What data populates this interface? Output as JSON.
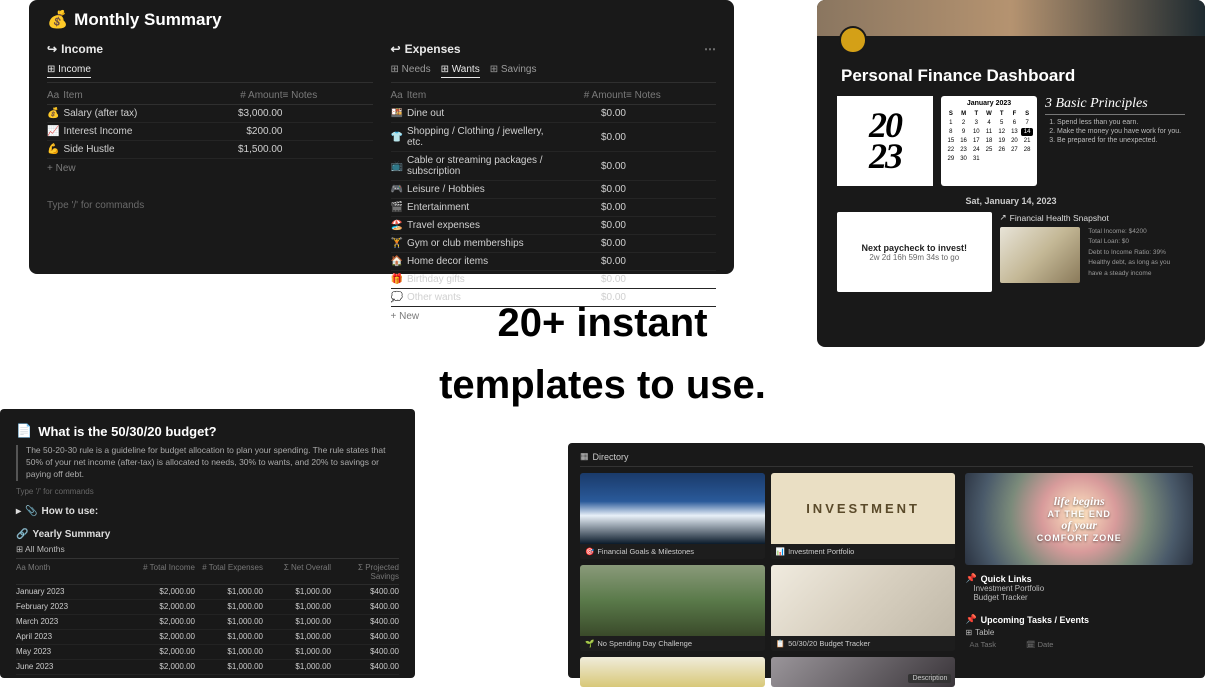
{
  "headline": {
    "line1": "20+ instant",
    "line2": "templates to use."
  },
  "monthly": {
    "title": "Monthly Summary",
    "icon": "💰",
    "income": {
      "heading": "Income",
      "arrow": "↪",
      "tabs": [
        {
          "label": "Income",
          "icon": "⊞"
        }
      ],
      "cols": {
        "item": "Item",
        "amount": "Amount",
        "notes": "Notes"
      },
      "rows": [
        {
          "icon": "💰",
          "name": "Salary (after tax)",
          "amount": "$3,000.00"
        },
        {
          "icon": "📈",
          "name": "Interest Income",
          "amount": "$200.00"
        },
        {
          "icon": "💪",
          "name": "Side Hustle",
          "amount": "$1,500.00"
        }
      ],
      "new": "+ New",
      "cmd": "Type '/' for commands"
    },
    "expenses": {
      "heading": "Expenses",
      "arrow": "↩",
      "tabs": [
        {
          "label": "Needs",
          "icon": "⊞"
        },
        {
          "label": "Wants",
          "icon": "⊞",
          "active": true
        },
        {
          "label": "Savings",
          "icon": "⊞"
        }
      ],
      "cols": {
        "item": "Item",
        "amount": "Amount",
        "notes": "Notes"
      },
      "rows": [
        {
          "icon": "🍱",
          "name": "Dine out",
          "amount": "$0.00"
        },
        {
          "icon": "👕",
          "name": "Shopping / Clothing / jewellery, etc.",
          "amount": "$0.00"
        },
        {
          "icon": "📺",
          "name": "Cable or streaming packages / subscription",
          "amount": "$0.00"
        },
        {
          "icon": "🎮",
          "name": "Leisure / Hobbies",
          "amount": "$0.00"
        },
        {
          "icon": "🎬",
          "name": "Entertainment",
          "amount": "$0.00"
        },
        {
          "icon": "🏖️",
          "name": "Travel expenses",
          "amount": "$0.00"
        },
        {
          "icon": "🏋️",
          "name": "Gym or club memberships",
          "amount": "$0.00"
        },
        {
          "icon": "🏠",
          "name": "Home decor items",
          "amount": "$0.00"
        },
        {
          "icon": "🎁",
          "name": "Birthday gifts",
          "amount": "$0.00"
        },
        {
          "icon": "💭",
          "name": "Other wants",
          "amount": "$0.00"
        }
      ],
      "new": "+ New"
    }
  },
  "dashboard": {
    "title": "Personal Finance Dashboard",
    "year_a": "20",
    "year_b": "23",
    "cal": {
      "month": "January 2023",
      "heads": [
        "S",
        "M",
        "T",
        "W",
        "T",
        "F",
        "S"
      ],
      "days": [
        1,
        2,
        3,
        4,
        5,
        6,
        7,
        8,
        9,
        10,
        11,
        12,
        13,
        14,
        15,
        16,
        17,
        18,
        19,
        20,
        21,
        22,
        23,
        24,
        25,
        26,
        27,
        28,
        29,
        30,
        31
      ],
      "selected": 14
    },
    "principles": {
      "title": "3 Basic Principles",
      "items": [
        "Spend less than you earn.",
        "Make the money you have work for you.",
        "Be prepared for the unexpected."
      ]
    },
    "date": "Sat, January 14, 2023",
    "paycheck": {
      "title": "Next paycheck to invest!",
      "sub": "2w 2d 16h 59m 34s to go"
    },
    "health": {
      "title": "Financial Health Snapshot",
      "stats": [
        "Total Income: $4200",
        "Total Loan: $0",
        "Debt to Income Ratio: 39%",
        "Healthy debt, as long as you have a steady income"
      ]
    }
  },
  "rule": {
    "title": "What is the 50/30/20 budget?",
    "icon": "📄",
    "desc": "The 50-20-30 rule is a guideline for budget allocation to plan your spending. The rule states that 50% of your net income (after-tax) is allocated to needs, 30% to wants, and 20% to savings or paying off debt.",
    "cmd": "Type '/' for commands",
    "how": "How to use:",
    "how_icon": "📎",
    "how_toggle": "▸",
    "ys": "Yearly Summary",
    "ys_icon": "🔗",
    "tab": "All Months",
    "tab_icon": "⊞",
    "cols": {
      "month": "Month",
      "income": "Total Income",
      "expenses": "Total Expenses",
      "net": "Net Overall",
      "savings": "Projected Savings"
    },
    "rows": [
      {
        "m": "January 2023",
        "i": "$2,000.00",
        "e": "$1,000.00",
        "n": "$1,000.00",
        "s": "$400.00"
      },
      {
        "m": "February 2023",
        "i": "$2,000.00",
        "e": "$1,000.00",
        "n": "$1,000.00",
        "s": "$400.00"
      },
      {
        "m": "March 2023",
        "i": "$2,000.00",
        "e": "$1,000.00",
        "n": "$1,000.00",
        "s": "$400.00"
      },
      {
        "m": "April 2023",
        "i": "$2,000.00",
        "e": "$1,000.00",
        "n": "$1,000.00",
        "s": "$400.00"
      },
      {
        "m": "May 2023",
        "i": "$2,000.00",
        "e": "$1,000.00",
        "n": "$1,000.00",
        "s": "$400.00"
      },
      {
        "m": "June 2023",
        "i": "$2,000.00",
        "e": "$1,000.00",
        "n": "$1,000.00",
        "s": "$400.00"
      }
    ]
  },
  "gallery": {
    "tab": "Directory",
    "cards": [
      {
        "caption": "Financial Goals & Milestones",
        "icon": "🎯"
      },
      {
        "caption": "Investment Portfolio",
        "icon": "📊",
        "label": "INVESTMENT"
      },
      {
        "caption": "No Spending Day Challenge",
        "icon": "🌱"
      },
      {
        "caption": "50/30/20 Budget Tracker",
        "icon": "📋"
      }
    ],
    "poster": {
      "l1": "life begins",
      "l2": "AT THE END",
      "l3": "of your",
      "l4": "COMFORT ZONE"
    },
    "ql": {
      "title": "Quick Links",
      "icon": "📌",
      "items": [
        "Investment Portfolio",
        "Budget Tracker"
      ]
    },
    "ut": {
      "title": "Upcoming Tasks / Events",
      "icon": "📌",
      "tab": "Table",
      "tab_icon": "⊞",
      "cols": {
        "task": "Task",
        "date": "Date"
      }
    },
    "descchip": "Description"
  }
}
